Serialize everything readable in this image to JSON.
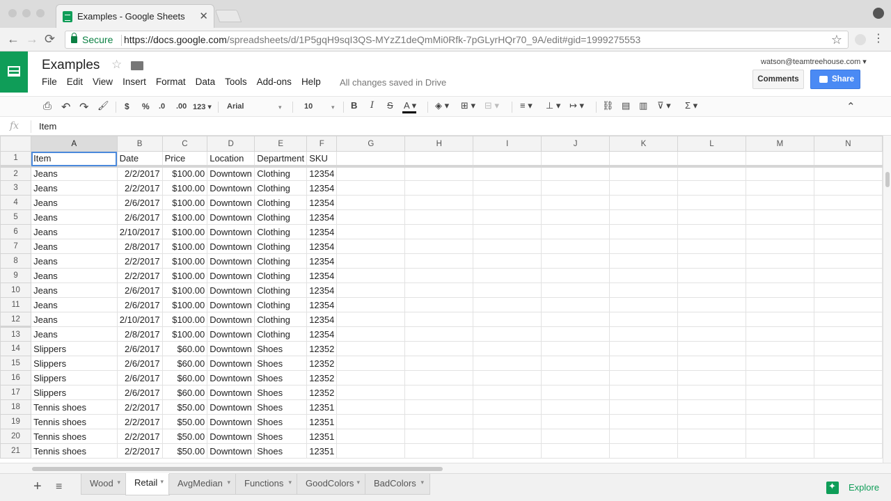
{
  "browser": {
    "tab_title": "Examples - Google Sheets",
    "tab_close": "✕",
    "secure_label": "Secure",
    "url_host": "https://docs.google.com",
    "url_path": "/spreadsheets/d/1P5gqH9sqI3QS-MYzZ1deQmMi0Rfk-7pGLyrHQr70_9A/edit#gid=1999275553",
    "back": "←",
    "forward": "→",
    "reload": "⟳",
    "star": "☆",
    "menu": "⋮"
  },
  "app": {
    "title": "Examples",
    "title_star": "☆",
    "menu": [
      "File",
      "Edit",
      "View",
      "Insert",
      "Format",
      "Data",
      "Tools",
      "Add-ons",
      "Help"
    ],
    "saved_status": "All changes saved in Drive",
    "user_email": "watson@teamtreehouse.com ▾",
    "comments_label": "Comments",
    "share_label": "Share"
  },
  "toolbar": {
    "print": "⎙",
    "undo": "↶",
    "redo": "↷",
    "paint_format": "🖌",
    "currency": "$",
    "percent": "%",
    "dec_decrease": ".0",
    "dec_increase": ".00",
    "more_formats": "123 ▾",
    "font": "Arial",
    "font_caret": "▾",
    "font_size": "10",
    "bold": "B",
    "italic": "I",
    "strike": "S",
    "text_color": "A ▾",
    "fill": "◈ ▾",
    "borders": "⊞ ▾",
    "merge": "⊟ ▾",
    "h_align": "≡ ▾",
    "v_align": "⊥ ▾",
    "wrap": "↦ ▾",
    "link": "⛓",
    "comment": "▤",
    "chart": "▥",
    "filter": "⊽ ▾",
    "functions": "Σ ▾",
    "collapse": "⌃"
  },
  "formula_bar": {
    "fx": "fx",
    "value": "Item"
  },
  "grid": {
    "columns": [
      "A",
      "B",
      "C",
      "D",
      "E",
      "F",
      "G",
      "H",
      "I",
      "J",
      "K",
      "L",
      "M",
      "N"
    ],
    "header_row": [
      "Item",
      "Date",
      "Price",
      "Location",
      "Department",
      "SKU"
    ],
    "rows": [
      [
        "Jeans",
        "2/2/2017",
        "$100.00",
        "Downtown",
        "Clothing",
        "12354"
      ],
      [
        "Jeans",
        "2/2/2017",
        "$100.00",
        "Downtown",
        "Clothing",
        "12354"
      ],
      [
        "Jeans",
        "2/6/2017",
        "$100.00",
        "Downtown",
        "Clothing",
        "12354"
      ],
      [
        "Jeans",
        "2/6/2017",
        "$100.00",
        "Downtown",
        "Clothing",
        "12354"
      ],
      [
        "Jeans",
        "2/10/2017",
        "$100.00",
        "Downtown",
        "Clothing",
        "12354"
      ],
      [
        "Jeans",
        "2/8/2017",
        "$100.00",
        "Downtown",
        "Clothing",
        "12354"
      ],
      [
        "Jeans",
        "2/2/2017",
        "$100.00",
        "Downtown",
        "Clothing",
        "12354"
      ],
      [
        "Jeans",
        "2/2/2017",
        "$100.00",
        "Downtown",
        "Clothing",
        "12354"
      ],
      [
        "Jeans",
        "2/6/2017",
        "$100.00",
        "Downtown",
        "Clothing",
        "12354"
      ],
      [
        "Jeans",
        "2/6/2017",
        "$100.00",
        "Downtown",
        "Clothing",
        "12354"
      ],
      [
        "Jeans",
        "2/10/2017",
        "$100.00",
        "Downtown",
        "Clothing",
        "12354"
      ],
      [
        "Jeans",
        "2/8/2017",
        "$100.00",
        "Downtown",
        "Clothing",
        "12354"
      ],
      [
        "Slippers",
        "2/6/2017",
        "$60.00",
        "Downtown",
        "Shoes",
        "12352"
      ],
      [
        "Slippers",
        "2/6/2017",
        "$60.00",
        "Downtown",
        "Shoes",
        "12352"
      ],
      [
        "Slippers",
        "2/6/2017",
        "$60.00",
        "Downtown",
        "Shoes",
        "12352"
      ],
      [
        "Slippers",
        "2/6/2017",
        "$60.00",
        "Downtown",
        "Shoes",
        "12352"
      ],
      [
        "Tennis shoes",
        "2/2/2017",
        "$50.00",
        "Downtown",
        "Shoes",
        "12351"
      ],
      [
        "Tennis shoes",
        "2/2/2017",
        "$50.00",
        "Downtown",
        "Shoes",
        "12351"
      ],
      [
        "Tennis shoes",
        "2/2/2017",
        "$50.00",
        "Downtown",
        "Shoes",
        "12351"
      ],
      [
        "Tennis shoes",
        "2/2/2017",
        "$50.00",
        "Downtown",
        "Shoes",
        "12351"
      ]
    ]
  },
  "sheet_tabs": {
    "add": "+",
    "all": "≡",
    "tabs": [
      "Wood",
      "Retail",
      "AvgMedian",
      "Functions",
      "GoodColors",
      "BadColors"
    ],
    "active": "Retail",
    "caret": "▾",
    "explore_label": "Explore"
  },
  "colors": {
    "brand_green": "#0f9d58",
    "share_blue": "#4a8af4",
    "selection_blue": "#4a89dc"
  }
}
